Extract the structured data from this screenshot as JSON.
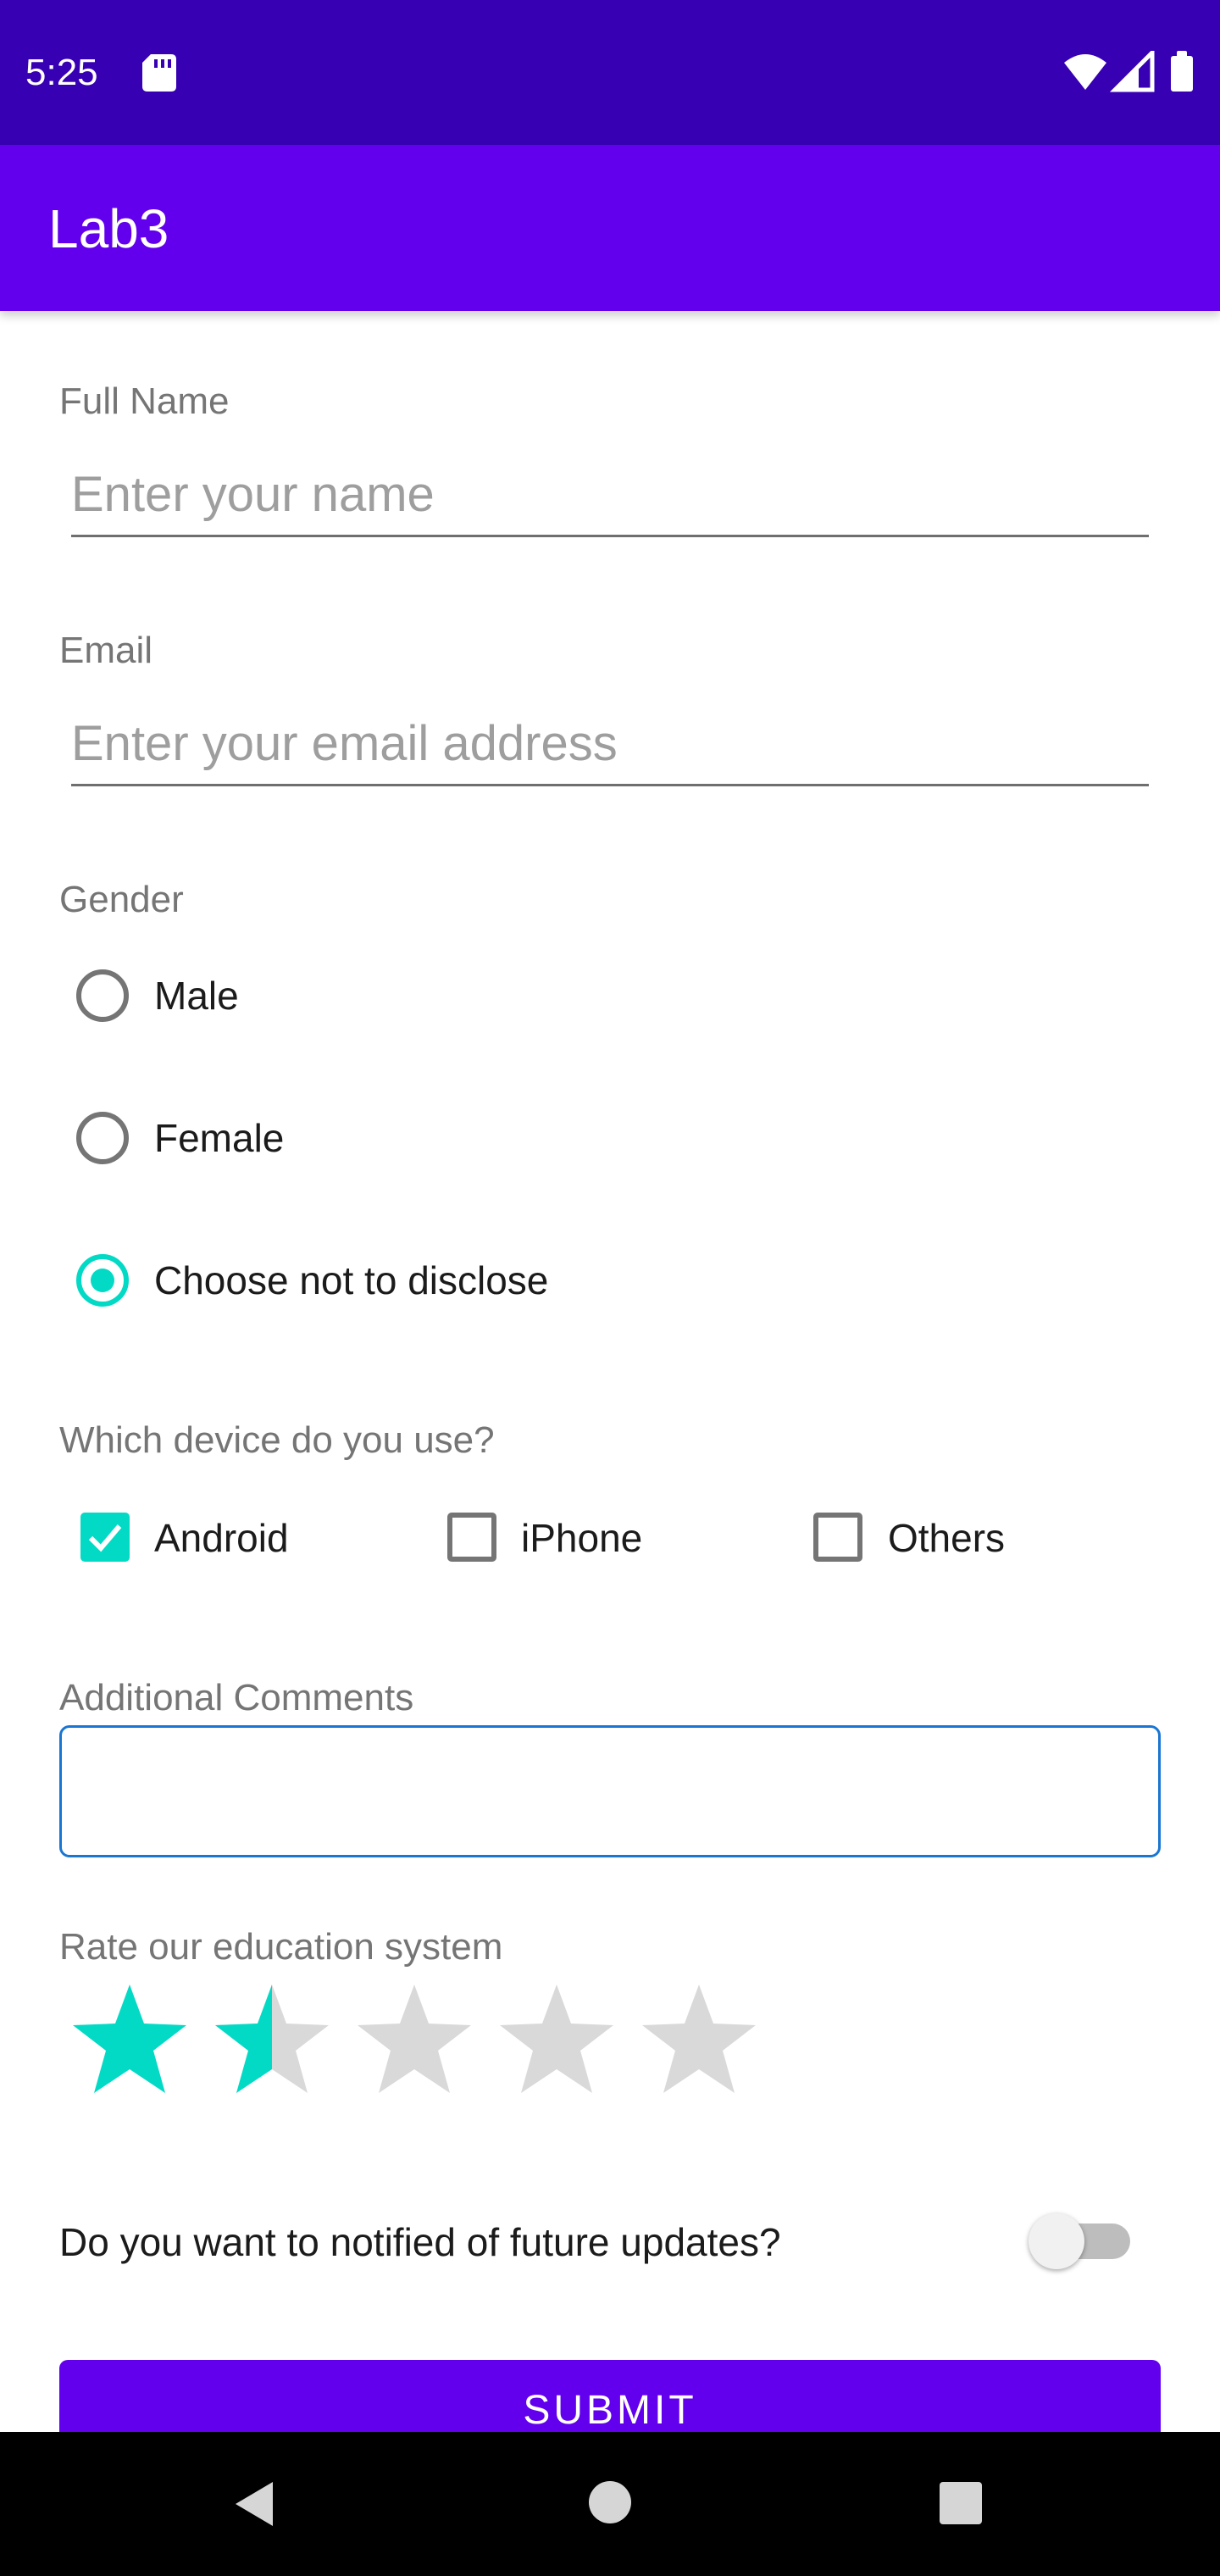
{
  "status_bar": {
    "time": "5:25"
  },
  "app_bar": {
    "title": "Lab3"
  },
  "form": {
    "full_name": {
      "label": "Full Name",
      "placeholder": "Enter your name"
    },
    "email": {
      "label": "Email",
      "placeholder": "Enter your email address"
    },
    "gender": {
      "label": "Gender",
      "options": [
        "Male",
        "Female",
        "Choose not to disclose"
      ],
      "selected": "Choose not to disclose"
    },
    "device": {
      "label": "Which device do you use?",
      "options": [
        {
          "label": "Android",
          "checked": true
        },
        {
          "label": "iPhone",
          "checked": false
        },
        {
          "label": "Others",
          "checked": false
        }
      ]
    },
    "comments": {
      "label": "Additional Comments",
      "value": ""
    },
    "rating": {
      "label": "Rate our education system",
      "value": 1.5,
      "max": 5
    },
    "notify": {
      "question": "Do you want to notified of future updates?",
      "enabled": false
    },
    "submit_label": "SUBMIT"
  },
  "colors": {
    "status_bar": "#3700B3",
    "primary": "#6200EE",
    "accent": "#03DAC5",
    "focus_border": "#1976D2",
    "star_empty": "#D9D9D9"
  }
}
